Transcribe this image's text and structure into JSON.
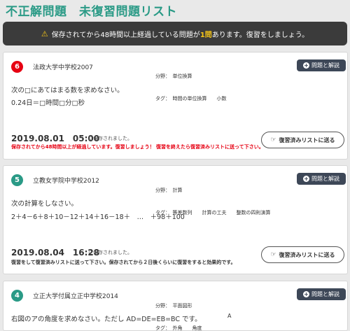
{
  "page": {
    "title": "不正解問題　未復習問題リスト"
  },
  "notice": {
    "prefix": "保存されてから48時間以上経過している問題が",
    "count": "1問",
    "suffix": "あります。復習をしましょう。"
  },
  "colors": {
    "title": "#2a9a86",
    "badge_red": "#e60012",
    "badge_green": "#2a9a86",
    "button_dark": "#3d4757",
    "warning": "#f5c518"
  },
  "cards": [
    {
      "number": "6",
      "school": "法政大学中学校2007",
      "field_label": "分野：",
      "field": "単位換算",
      "tag_label": "タグ：",
      "tags": "時間の単位換算　　小数",
      "explain_button": "問題と解説",
      "question_line1": "次の□にあてはまる数を求めなさい。",
      "question_line2": "0.24日＝□時間□分□秒",
      "saved_date": "2019.08.01　05:00",
      "saved_suffix": "に保存されました。",
      "remark": "保存されてから48時間以上が経過しています。復習しましょう！ 復習を終えたら復習済みリストに送って下さい。",
      "review_button": "復習済みリストに送る"
    },
    {
      "number": "5",
      "school": "立教女学院中学校2012",
      "field_label": "分野：",
      "field": "計算",
      "tag_label": "タグ：",
      "tags": "等差数列　　計算の工夫　　整数の四則演算",
      "explain_button": "問題と解説",
      "question_line1": "次の計算をしなさい。",
      "question_line2": "2＋4－6＋8＋10－12＋14＋16－18＋　…　＋98＋100",
      "saved_date": "2019.08.04　16:28",
      "saved_suffix": "に保存されました。",
      "remark": "復習をして復習済みリストに送って下さい。保存されてから２日後くらいに復習をすると効果的です。",
      "review_button": "復習済みリストに送る"
    },
    {
      "number": "4",
      "school": "立正大学付属立正中学校2014",
      "field_label": "分野：",
      "field": "平面図形",
      "tag_label": "タグ：",
      "tags": "外角　　角度",
      "explain_button": "問題と解説",
      "question_line1": "右図のアの角度を求めなさい。ただし AD=DE=EB=BC です。",
      "figure_label": "A"
    }
  ]
}
